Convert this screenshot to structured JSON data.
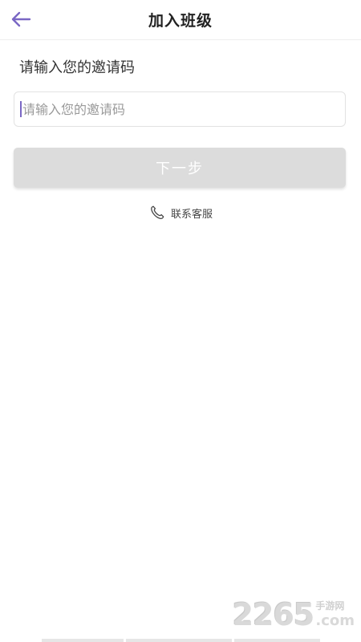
{
  "header": {
    "title": "加入班级",
    "back_icon": "back-arrow-icon"
  },
  "form": {
    "section_label": "请输入您的邀请码",
    "invite_code_value": "",
    "invite_code_placeholder": "请输入您的邀请码",
    "next_button_label": "下一步"
  },
  "contact": {
    "label": "联系客服",
    "icon": "phone-icon"
  },
  "watermark": {
    "digits": "2265",
    "brand": "手游网",
    "suffix": ".com"
  },
  "colors": {
    "accent": "#7a67c4",
    "button_disabled": "#dcdcdc",
    "divider": "#eeeeee"
  }
}
